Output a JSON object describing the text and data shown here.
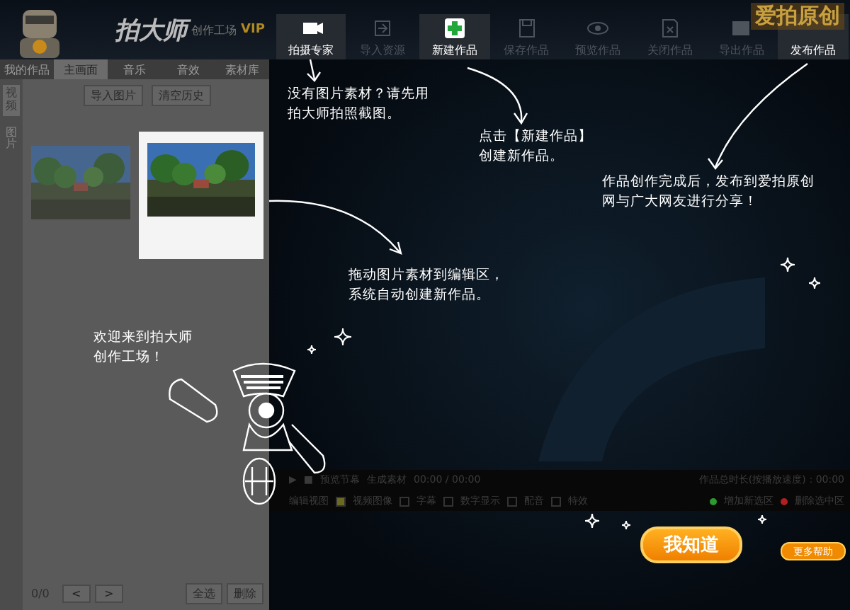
{
  "app": {
    "name": "拍大师",
    "subtitle": "创作工场",
    "badge": "VIP",
    "brand": "爱拍原创"
  },
  "toolbar": [
    {
      "label": "拍摄专家",
      "highlighted": true
    },
    {
      "label": "导入资源",
      "highlighted": false
    },
    {
      "label": "新建作品",
      "highlighted": true
    },
    {
      "label": "保存作品",
      "highlighted": false
    },
    {
      "label": "预览作品",
      "highlighted": false
    },
    {
      "label": "关闭作品",
      "highlighted": false
    },
    {
      "label": "导出作品",
      "highlighted": false
    },
    {
      "label": "发布作品",
      "highlighted": true
    }
  ],
  "panel_tabs": [
    {
      "label": "我的作品",
      "selected": false
    },
    {
      "label": "主画面",
      "selected": true
    },
    {
      "label": "音乐",
      "selected": false
    },
    {
      "label": "音效",
      "selected": false
    },
    {
      "label": "素材库",
      "selected": false
    }
  ],
  "side_tabs": [
    {
      "label": "视频",
      "selected": true
    },
    {
      "label": "图片",
      "selected": false
    }
  ],
  "panel_buttons": [
    "导入图片",
    "清空历史"
  ],
  "thumbnails": [
    {
      "kind": "picture",
      "highlighted": false
    },
    {
      "kind": "picture",
      "highlighted": true
    }
  ],
  "pager": {
    "count": "0/0",
    "prev": "<",
    "next": ">"
  },
  "footer_buttons": [
    "全选",
    "删除"
  ],
  "timeline": {
    "play": "▶",
    "stop": "■",
    "preview": "预览节幕",
    "generate": "生成素材",
    "time": "00:00 / 00:00",
    "total": "作品总时长(按播放速度)：00:00"
  },
  "tracks": {
    "label": "编辑视图",
    "options": [
      {
        "label": "视频图像",
        "checked": true
      },
      {
        "label": "字幕",
        "checked": false
      },
      {
        "label": "数字显示",
        "checked": false
      },
      {
        "label": "配音",
        "checked": false
      },
      {
        "label": "特效",
        "checked": false
      }
    ]
  },
  "zones": [
    {
      "label": "增加新选区",
      "color": "#2e9a2e"
    },
    {
      "label": "删除选中区",
      "color": "#b02020"
    }
  ],
  "tips": [
    "没有图片素材？请先用拍大师拍照截图。",
    "点击【新建作品】创建新作品。",
    "作品创作完成后，发布到爱拍原创网与广大网友进行分享！",
    "拖动图片素材到编辑区，系统自动创建新作品。",
    "欢迎来到拍大师创作工场！"
  ],
  "dismiss_button": "我知道",
  "help_button": "更多帮助"
}
